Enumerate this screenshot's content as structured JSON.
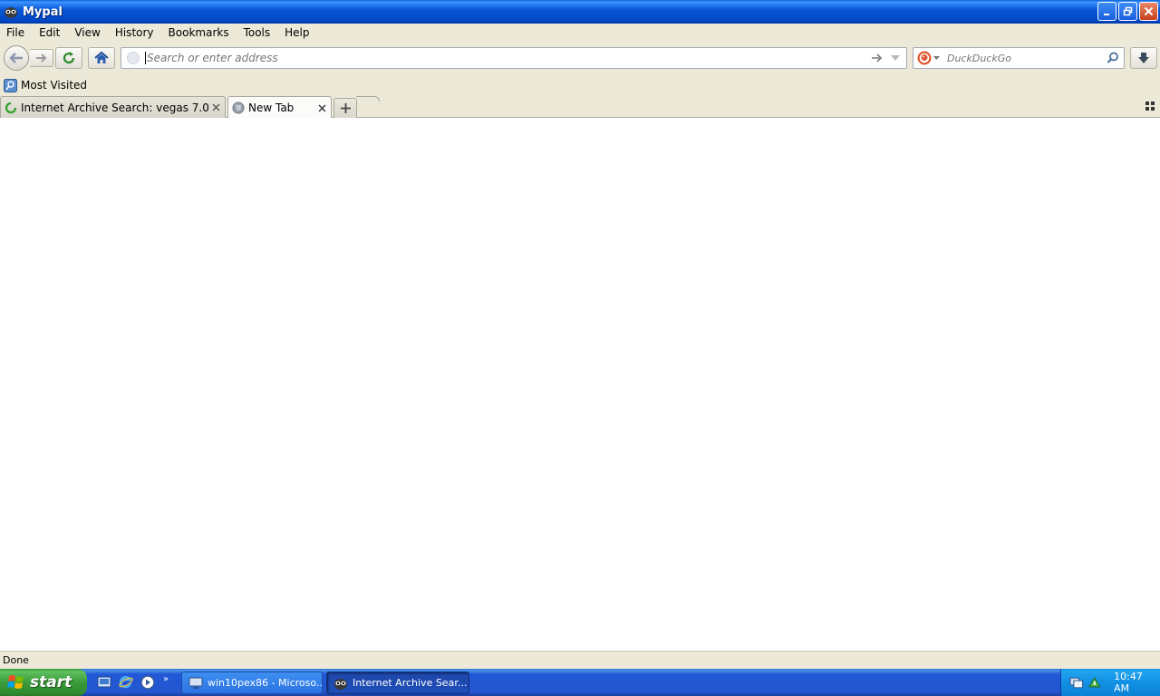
{
  "window": {
    "title": "Mypal"
  },
  "menu": [
    "File",
    "Edit",
    "View",
    "History",
    "Bookmarks",
    "Tools",
    "Help"
  ],
  "navbar": {
    "url_placeholder": "Search or enter address",
    "search_placeholder": "DuckDuckGo"
  },
  "bookmarks": {
    "items": [
      {
        "label": "Most Visited"
      }
    ]
  },
  "tabs": [
    {
      "label": "Internet Archive Search: vegas 7.0",
      "active": false
    },
    {
      "label": "New Tab",
      "active": true
    }
  ],
  "status": {
    "text": "Done"
  },
  "taskbar": {
    "start_label": "start",
    "tasks": [
      {
        "label": "win10pex86 - Microso...",
        "active": false
      },
      {
        "label": "Internet Archive Sear...",
        "active": true
      }
    ],
    "clock": "10:47 AM"
  },
  "icons": {
    "back": "back-arrow-icon",
    "forward": "forward-arrow-icon",
    "reload": "reload-icon",
    "home": "home-icon",
    "go": "go-arrow-icon",
    "search_engine": "duckduckgo-icon",
    "search": "magnifier-icon",
    "downloads": "download-icon"
  },
  "colors": {
    "titlebar": "#0a58d6",
    "chrome": "#ece9d8",
    "taskbar": "#2457d0",
    "start": "#3a9b3a",
    "tray": "#1290e4",
    "content": "#ffffff"
  }
}
